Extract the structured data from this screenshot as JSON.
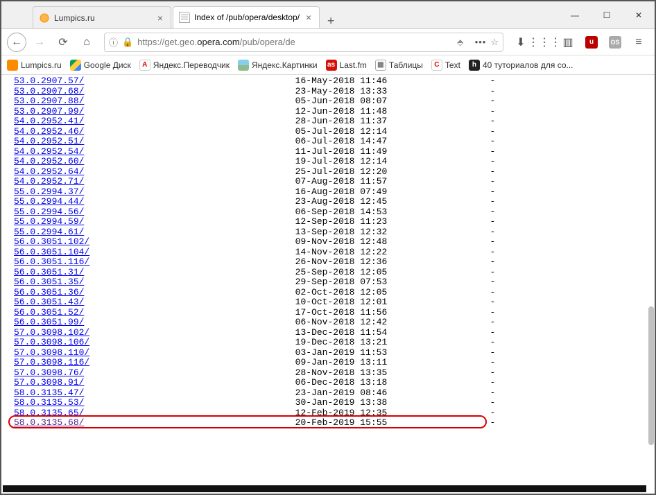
{
  "window": {
    "controls": {
      "min": "—",
      "max": "☐",
      "close": "✕"
    }
  },
  "tabs": {
    "items": [
      {
        "title": "Lumpics.ru",
        "active": false
      },
      {
        "title": "Index of /pub/opera/desktop/",
        "active": true
      }
    ],
    "newtab_glyph": "+"
  },
  "toolbar": {
    "info_glyph": "ⓘ",
    "lock_glyph": "🔒",
    "percent": "⬘",
    "dots": "•••",
    "star": "☆",
    "download": "⬇",
    "library": "⋮⋮⋮",
    "sidebar": "▥",
    "ublock": "u",
    "os": "OS",
    "menu": "≡"
  },
  "nav": {
    "back": "←",
    "fwd": "→",
    "reload": "⟳",
    "home": "⌂"
  },
  "url": {
    "prefix": "https://",
    "sub": "get.geo.",
    "domain": "opera.com",
    "path": "/pub/opera/de"
  },
  "bookmarks": [
    {
      "label": "Lumpics.ru",
      "icon_bg": "#fb8c00",
      "icon_txt": ""
    },
    {
      "label": "Google Диск",
      "icon_bg": "linear-gradient(135deg,#0f9d58 33%,#ffcd40 33% 66%,#4285f4 66%)",
      "icon_txt": ""
    },
    {
      "label": "Яндекс.Переводчик",
      "icon_bg": "#ffffff",
      "icon_txt": "A",
      "icon_fg": "#d00",
      "border": "1px solid #ccc"
    },
    {
      "label": "Яндекс.Картинки",
      "icon_bg": "linear-gradient(#87ceeb 50%,#8fbc8f 50%)",
      "icon_txt": ""
    },
    {
      "label": "Last.fm",
      "icon_bg": "#d51007",
      "icon_txt": "as"
    },
    {
      "label": "Таблицы",
      "icon_bg": "#fff",
      "icon_txt": "▦",
      "icon_fg": "#777",
      "border": "1px solid #aaa"
    },
    {
      "label": "Text",
      "icon_bg": "#fff",
      "icon_txt": "C",
      "icon_fg": "#d00",
      "border": "1px solid #ccc"
    },
    {
      "label": "40 туториалов для со...",
      "icon_bg": "#222",
      "icon_txt": "h"
    }
  ],
  "listing": {
    "dash": "-",
    "highlighted_index": 35,
    "rows": [
      {
        "name": "53.0.2907.57/",
        "date": "16-May-2018 11:46"
      },
      {
        "name": "53.0.2907.68/",
        "date": "23-May-2018 13:33"
      },
      {
        "name": "53.0.2907.88/",
        "date": "05-Jun-2018 08:07"
      },
      {
        "name": "53.0.2907.99/",
        "date": "12-Jun-2018 11:48"
      },
      {
        "name": "54.0.2952.41/",
        "date": "28-Jun-2018 11:37"
      },
      {
        "name": "54.0.2952.46/",
        "date": "05-Jul-2018 12:14"
      },
      {
        "name": "54.0.2952.51/",
        "date": "06-Jul-2018 14:47"
      },
      {
        "name": "54.0.2952.54/",
        "date": "11-Jul-2018 11:49"
      },
      {
        "name": "54.0.2952.60/",
        "date": "19-Jul-2018 12:14"
      },
      {
        "name": "54.0.2952.64/",
        "date": "25-Jul-2018 12:20"
      },
      {
        "name": "54.0.2952.71/",
        "date": "07-Aug-2018 11:57"
      },
      {
        "name": "55.0.2994.37/",
        "date": "16-Aug-2018 07:49"
      },
      {
        "name": "55.0.2994.44/",
        "date": "23-Aug-2018 12:45"
      },
      {
        "name": "55.0.2994.56/",
        "date": "06-Sep-2018 14:53"
      },
      {
        "name": "55.0.2994.59/",
        "date": "12-Sep-2018 11:23"
      },
      {
        "name": "55.0.2994.61/",
        "date": "13-Sep-2018 12:32"
      },
      {
        "name": "56.0.3051.102/",
        "date": "09-Nov-2018 12:48"
      },
      {
        "name": "56.0.3051.104/",
        "date": "14-Nov-2018 12:22"
      },
      {
        "name": "56.0.3051.116/",
        "date": "26-Nov-2018 12:36"
      },
      {
        "name": "56.0.3051.31/",
        "date": "25-Sep-2018 12:05"
      },
      {
        "name": "56.0.3051.35/",
        "date": "29-Sep-2018 07:53"
      },
      {
        "name": "56.0.3051.36/",
        "date": "02-Oct-2018 12:05"
      },
      {
        "name": "56.0.3051.43/",
        "date": "10-Oct-2018 12:01"
      },
      {
        "name": "56.0.3051.52/",
        "date": "17-Oct-2018 11:56"
      },
      {
        "name": "56.0.3051.99/",
        "date": "06-Nov-2018 12:42"
      },
      {
        "name": "57.0.3098.102/",
        "date": "13-Dec-2018 11:54"
      },
      {
        "name": "57.0.3098.106/",
        "date": "19-Dec-2018 13:21"
      },
      {
        "name": "57.0.3098.110/",
        "date": "03-Jan-2019 11:53"
      },
      {
        "name": "57.0.3098.116/",
        "date": "09-Jan-2019 13:11"
      },
      {
        "name": "57.0.3098.76/",
        "date": "28-Nov-2018 13:35"
      },
      {
        "name": "57.0.3098.91/",
        "date": "06-Dec-2018 13:18"
      },
      {
        "name": "58.0.3135.47/",
        "date": "23-Jan-2019 08:46"
      },
      {
        "name": "58.0.3135.53/",
        "date": "30-Jan-2019 13:38"
      },
      {
        "name": "58.0.3135.65/",
        "date": "12-Feb-2019 12:35"
      },
      {
        "name": "58.0.3135.68/",
        "date": "20-Feb-2019 15:55",
        "visited": true
      }
    ]
  }
}
